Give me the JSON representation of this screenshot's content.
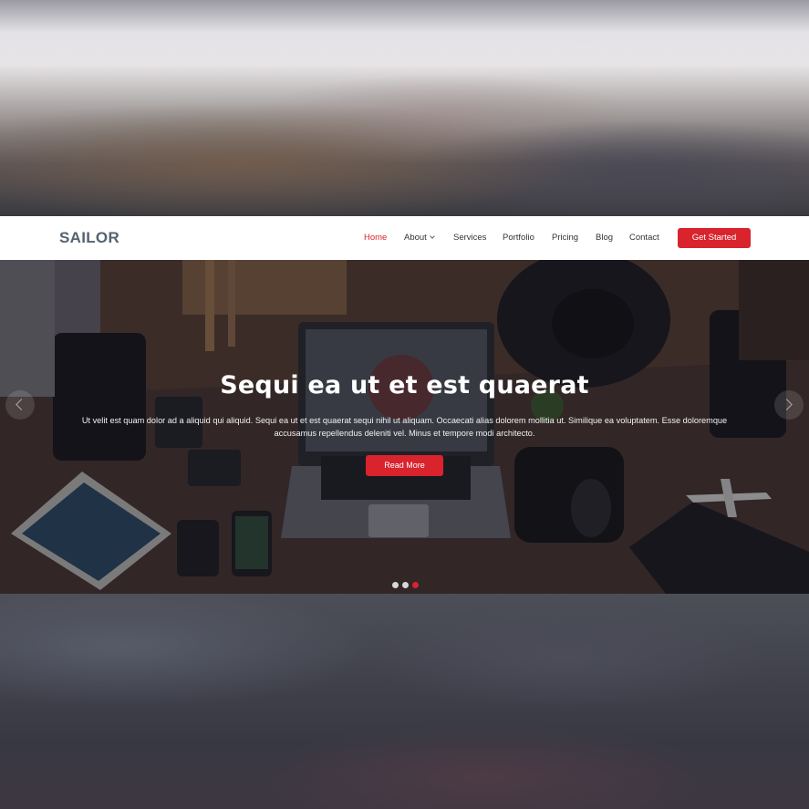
{
  "brand": {
    "name": "SAILOR"
  },
  "nav": {
    "items": [
      {
        "label": "Home",
        "active": true
      },
      {
        "label": "About",
        "dropdown": true
      },
      {
        "label": "Services"
      },
      {
        "label": "Portfolio"
      },
      {
        "label": "Pricing"
      },
      {
        "label": "Blog"
      },
      {
        "label": "Contact"
      }
    ],
    "cta_label": "Get Started"
  },
  "hero": {
    "title": "Sequi ea ut et est quaerat",
    "text": "Ut velit est quam dolor ad a aliquid qui aliquid. Sequi ea ut et est quaerat sequi nihil ut aliquam. Occaecati alias dolorem mollitia ut. Similique ea voluptatem. Esse doloremque accusamus repellendus deleniti vel. Minus et tempore modi architecto.",
    "button_label": "Read More",
    "prev_icon": "chevron-left-icon",
    "next_icon": "chevron-right-icon",
    "slides": 3,
    "active_slide": 3
  },
  "colors": {
    "accent": "#d9232d",
    "logo": "#556270",
    "header_bg": "#ffffff"
  }
}
